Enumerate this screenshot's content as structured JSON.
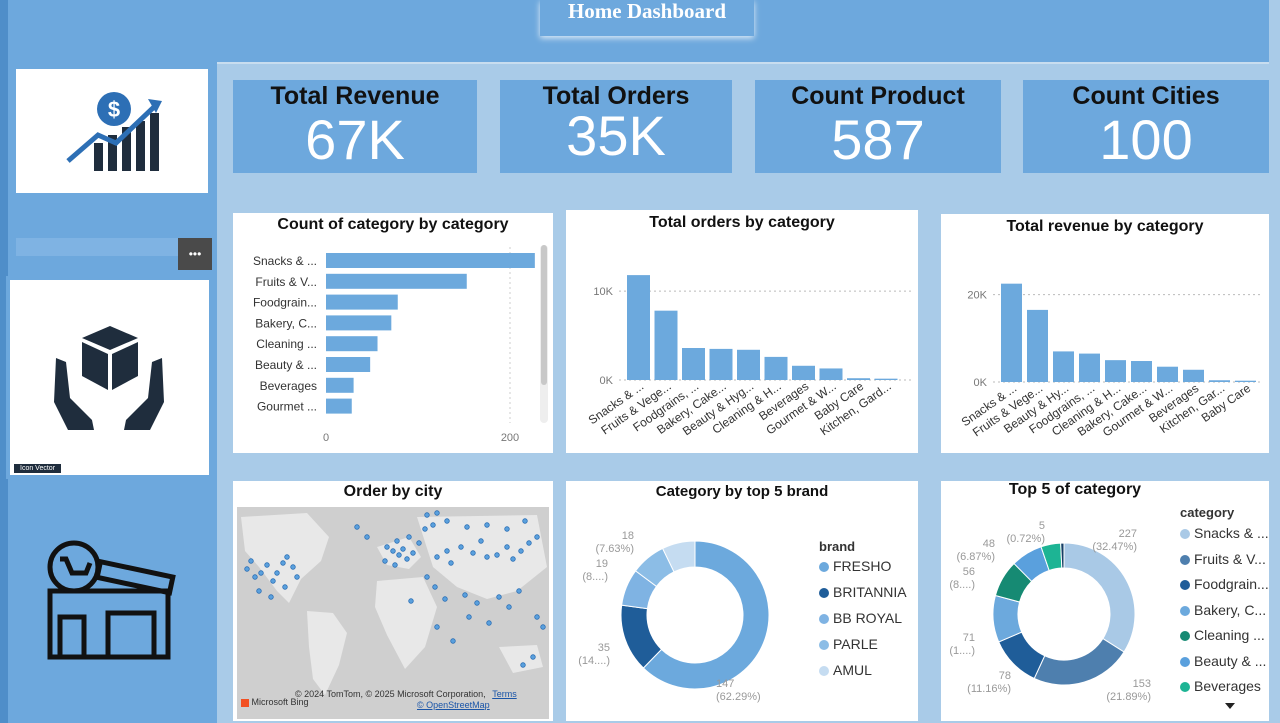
{
  "header": {
    "title": "Home Dashboard"
  },
  "sidebar": {
    "more_label": "•••",
    "icon_vector_label": "Icon Vector"
  },
  "kpis": [
    {
      "label": "Total Revenue",
      "value": "67K"
    },
    {
      "label": "Total Orders",
      "value": "35K"
    },
    {
      "label": "Count Product",
      "value": "587"
    },
    {
      "label": "Count Cities",
      "value": "100"
    }
  ],
  "colors": {
    "bar": "#6ca9dd",
    "accent": "#6da8dd"
  },
  "chart_data": [
    {
      "type": "bar",
      "orientation": "horizontal",
      "title": "Count of category by category",
      "categories": [
        "Snacks & ...",
        "Fruits & V...",
        "Foodgrain...",
        "Bakery, C...",
        "Cleaning ...",
        "Beauty & ...",
        "Beverages",
        "Gourmet ..."
      ],
      "values": [
        227,
        153,
        78,
        71,
        56,
        48,
        30,
        28
      ],
      "xticks": [
        "0",
        "200"
      ],
      "xlim": [
        0,
        250
      ]
    },
    {
      "type": "bar",
      "title": "Total orders by category",
      "categories": [
        "Snacks & ...",
        "Fruits & Vege...",
        "Foodgrains, ...",
        "Bakery, Cake...",
        "Beauty & Hyg...",
        "Cleaning & H...",
        "Beverages",
        "Gourmet & W...",
        "Baby Care",
        "Kitchen, Gard..."
      ],
      "values": [
        11800,
        7800,
        3600,
        3500,
        3400,
        2600,
        1600,
        1300,
        200,
        150
      ],
      "yticks": [
        "10K",
        "0K"
      ],
      "ylim": [
        0,
        13500
      ]
    },
    {
      "type": "bar",
      "title": "Total revenue by category",
      "categories": [
        "Snacks & ...",
        "Fruits & Vege...",
        "Beauty & Hy...",
        "Foodgrains, ...",
        "Cleaning & H...",
        "Bakery, Cake...",
        "Gourmet & W...",
        "Beverages",
        "Kitchen, Gar...",
        "Baby Care"
      ],
      "values": [
        22500,
        16500,
        7000,
        6500,
        5000,
        4800,
        3500,
        2800,
        400,
        300
      ],
      "yticks": [
        "20K",
        "0K"
      ],
      "ylim": [
        0,
        27000
      ]
    },
    {
      "type": "pie",
      "title": "Category by top 5 brand",
      "legend_title": "brand",
      "categories": [
        "FRESHO",
        "BRITANNIA",
        "BB ROYAL",
        "PARLE",
        "AMUL"
      ],
      "values": [
        147,
        35,
        19,
        18,
        17
      ],
      "colors": [
        "#6ca9dd",
        "#1f5d99",
        "#7fb3e3",
        "#8cbde6",
        "#c5dcf1"
      ],
      "labels": [
        {
          "count": "147",
          "pct": "(62.29%)"
        },
        {
          "count": "35",
          "pct": "(14....)"
        },
        {
          "count": "19",
          "pct": "(8....)"
        },
        {
          "count": "18",
          "pct": "(7.63%)"
        }
      ]
    },
    {
      "type": "pie",
      "title": "Top 5 of category",
      "legend_title": "category",
      "categories": [
        "Snacks & ...",
        "Fruits & V...",
        "Foodgrain...",
        "Bakery, C...",
        "Cleaning ...",
        "Beauty & ...",
        "Beverages"
      ],
      "values": [
        227,
        153,
        78,
        71,
        56,
        48,
        30,
        5
      ],
      "colors": [
        "#a9c9e6",
        "#4e7fae",
        "#1f5d99",
        "#6ca9dd",
        "#168a73",
        "#5aa0dd",
        "#1db494",
        "#143e66"
      ],
      "labels": [
        {
          "count": "227",
          "pct": "(32.47%)"
        },
        {
          "count": "153",
          "pct": "(21.89%)"
        },
        {
          "count": "78",
          "pct": "(11.16%)"
        },
        {
          "count": "71",
          "pct": "(1....)"
        },
        {
          "count": "56",
          "pct": "(8....)"
        },
        {
          "count": "48",
          "pct": "(6.87%)"
        },
        {
          "count": "5",
          "pct": "(0.72%)"
        }
      ]
    }
  ],
  "map": {
    "title": "Order by city",
    "attribution": "© 2024 TomTom, © 2025 Microsoft Corporation,",
    "terms": "Terms",
    "osm": "© OpenStreetMap",
    "bing": "Microsoft Bing"
  }
}
